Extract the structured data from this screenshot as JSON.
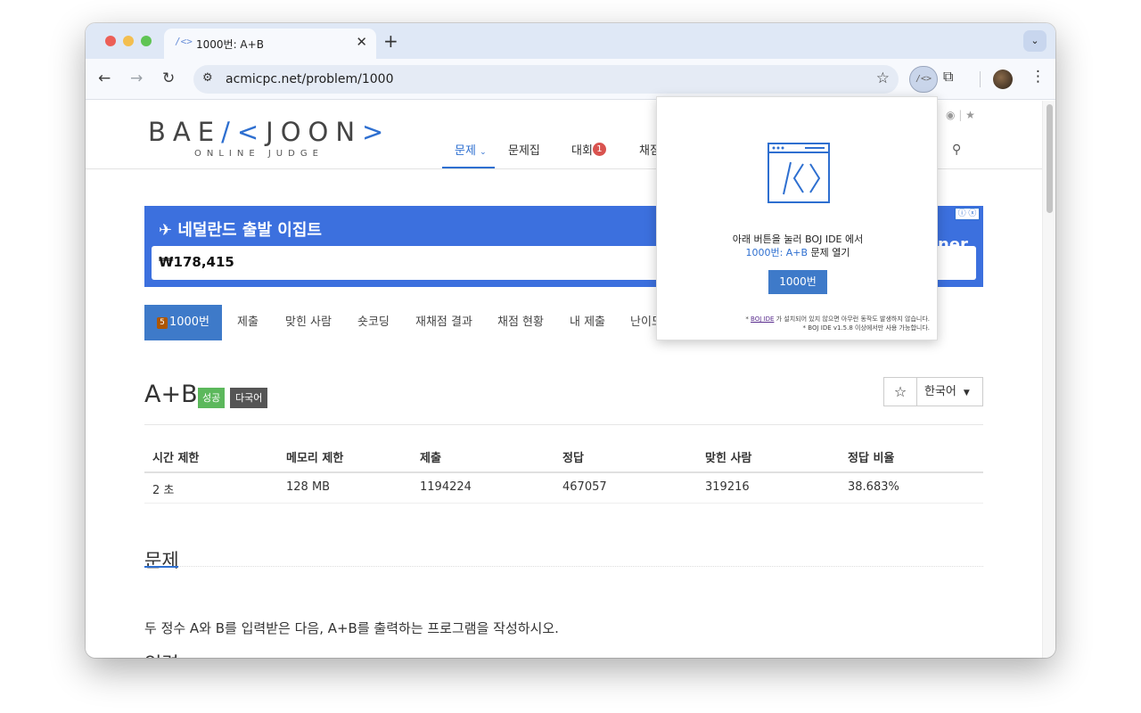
{
  "browser": {
    "tab_title": "1000번: A+B",
    "tab_favicon": "/<>",
    "url": "acmicpc.net/problem/1000"
  },
  "site": {
    "logo_left": "BAE",
    "logo_bracket1": "/<",
    "logo_mid": "JOON",
    "logo_bracket2": ">",
    "logo_sub": "ONLINE JUDGE",
    "nav": [
      {
        "label": "문제"
      },
      {
        "label": "문제집"
      },
      {
        "label": "대회"
      },
      {
        "label": "채점"
      }
    ],
    "contest_badge": "1",
    "colors": {
      "accent": "#2e6fd0",
      "success": "#5cb85c"
    }
  },
  "ad": {
    "title": "네덜란드 출발 이집트",
    "price": "₩178,415",
    "brand_fragment": "ner"
  },
  "problem_tabs": [
    {
      "label": "1000번",
      "tier": "5"
    },
    {
      "label": "제출"
    },
    {
      "label": "맞힌 사람"
    },
    {
      "label": "숏코딩"
    },
    {
      "label": "재채점 결과"
    },
    {
      "label": "채점 현황"
    },
    {
      "label": "내 제출"
    },
    {
      "label": "난이도"
    }
  ],
  "problem": {
    "title": "A+B",
    "label_success": "성공",
    "label_multilang": "다국어",
    "language": "한국어",
    "table": {
      "headers": [
        "시간 제한",
        "메모리 제한",
        "제출",
        "정답",
        "맞힌 사람",
        "정답 비율"
      ],
      "values": [
        "2 초",
        "128 MB",
        "1194224",
        "467057",
        "319216",
        "38.683%"
      ]
    },
    "sections": [
      {
        "title": "문제",
        "body": "두 정수 A와 B를 입력받은 다음, A+B를 출력하는 프로그램을 작성하시오."
      },
      {
        "title": "입력"
      }
    ]
  },
  "popup": {
    "line1": "아래 버튼을 눌러 BOJ IDE 에서",
    "link": "1000번: A+B",
    "line2_rest": " 문제 열기",
    "button": "1000번",
    "note_link": "BOJ IDE",
    "note1_rest": " 가 설치되어 있지 않으면 아무런 동작도 발생하지 않습니다.",
    "note2": "* BOJ IDE v1.5.8 이상에서만 사용 가능합니다."
  }
}
